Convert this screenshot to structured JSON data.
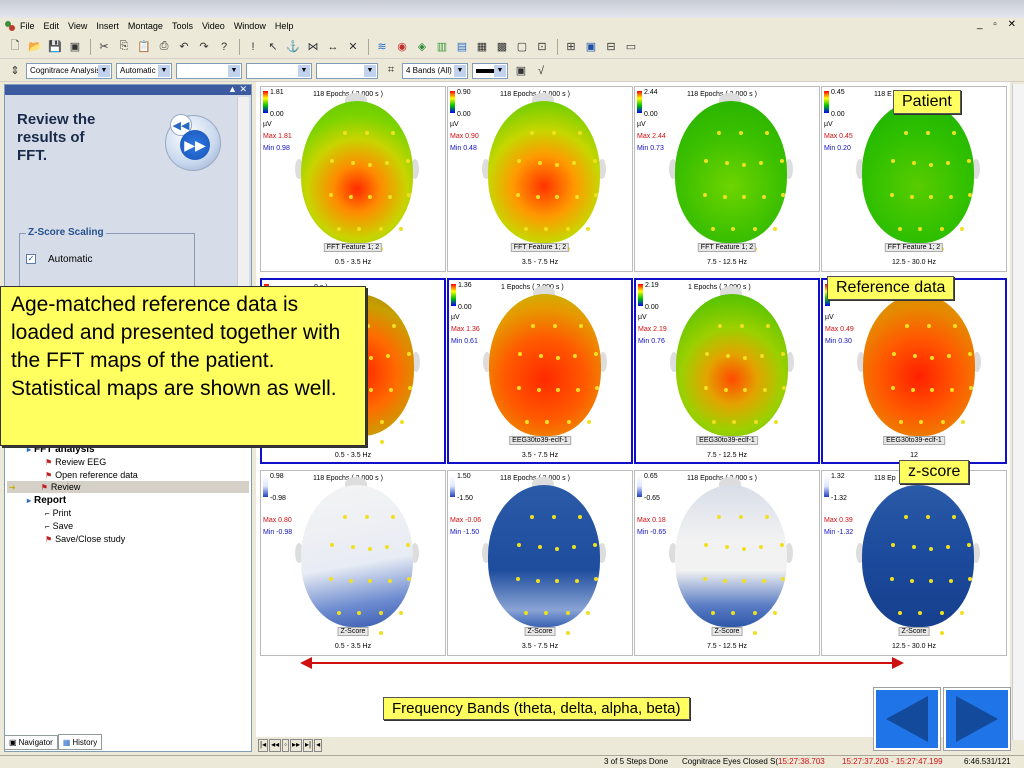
{
  "menu": [
    "File",
    "Edit",
    "View",
    "Insert",
    "Montage",
    "Tools",
    "Video",
    "Window",
    "Help"
  ],
  "window_controls": "_ ▫ ✕",
  "toolbar2": {
    "analysis_combo": "Cognitrace Analysis",
    "scaling_combo": "Automatic",
    "bands_combo": "4 Bands (All) (c"
  },
  "left_panel": {
    "heading": "Review the\nresults of\nFFT.",
    "zscore_title": "Z-Score Scaling",
    "automatic_label": "Automatic",
    "tree": {
      "fft_analysis": "FFT analysis",
      "review_eeg": "Review EEG",
      "open_reference": "Open reference data",
      "review": "Review",
      "report": "Report",
      "print": "Print",
      "save": "Save",
      "save_close": "Save/Close study"
    },
    "tabs": {
      "navigator": "Navigator",
      "history": "History"
    }
  },
  "grid": {
    "row1": [
      {
        "max": "1.81",
        "min": "0.00",
        "unit": "µV",
        "maxline": "Max  1.81",
        "minline": "Min  0.98",
        "epochs": "118 Epochs ( 2.000 s )",
        "feature": "FFT Feature 1; 2",
        "band": "0.5 - 3.5 Hz"
      },
      {
        "max": "0.90",
        "min": "0.00",
        "unit": "µV",
        "maxline": "Max  0.90",
        "minline": "Min  0.48",
        "epochs": "118 Epochs ( 2.000 s )",
        "feature": "FFT Feature 1; 2",
        "band": "3.5 - 7.5 Hz"
      },
      {
        "max": "2.44",
        "min": "0.00",
        "unit": "µV",
        "maxline": "Max  2.44",
        "minline": "Min  0.73",
        "epochs": "118 Epochs ( 2.000 s )",
        "feature": "FFT Feature 1; 2",
        "band": "7.5 - 12.5 Hz"
      },
      {
        "max": "0.45",
        "min": "0.00",
        "unit": "µV",
        "maxline": "Max  0.45",
        "minline": "Min  0.20",
        "epochs": "118 E",
        "feature": "FFT Feature 1; 2",
        "band": "12.5 - 30.0 Hz"
      }
    ],
    "row2": [
      {
        "max": "",
        "min": "",
        "unit": "",
        "maxline": "",
        "minline": "",
        "epochs": "0 s )",
        "feature": "eclf-1",
        "band": "0.5 - 3.5 Hz"
      },
      {
        "max": "1.36",
        "min": "0.00",
        "unit": "µV",
        "maxline": "Max  1.36",
        "minline": "Min  0.61",
        "epochs": "1 Epochs ( 2.000 s )",
        "feature": "EEG30to39-eclf-1",
        "band": "3.5 - 7.5 Hz"
      },
      {
        "max": "2.19",
        "min": "0.00",
        "unit": "µV",
        "maxline": "Max  2.19",
        "minline": "Min  0.76",
        "epochs": "1 Epochs ( 2.000 s )",
        "feature": "EEG30to39-eclf-1",
        "band": "7.5 - 12.5 Hz"
      },
      {
        "max": "",
        "min": "",
        "unit": "µV",
        "maxline": "Max  0.49",
        "minline": "Min  0.30",
        "epochs": "",
        "feature": "EEG30to39-eclf-1",
        "band": "12"
      }
    ],
    "row3": [
      {
        "max": "0.98",
        "min": "-0.98",
        "unit": "",
        "maxline": "Max  0.80",
        "minline": "Min  -0.98",
        "epochs": "118 Epochs ( 2.000 s )",
        "feature": "Z-Score",
        "band": "0.5 - 3.5 Hz"
      },
      {
        "max": "1.50",
        "min": "-1.50",
        "unit": "",
        "maxline": "Max  -0.06",
        "minline": "Min  -1.50",
        "epochs": "118 Epochs ( 2.000 s )",
        "feature": "Z-Score",
        "band": "3.5 - 7.5 Hz"
      },
      {
        "max": "0.65",
        "min": "-0.65",
        "unit": "",
        "maxline": "Max  0.18",
        "minline": "Min  -0.65",
        "epochs": "118 Epochs ( 2.000 s )",
        "feature": "Z-Score",
        "band": "7.5 - 12.5 Hz"
      },
      {
        "max": "1.32",
        "min": "-1.32",
        "unit": "",
        "maxline": "Max  0.39",
        "minline": "Min  -1.32",
        "epochs": "118 Ep",
        "feature": "Z-Score",
        "band": "12.5 - 30.0 Hz"
      }
    ]
  },
  "callouts": {
    "patient": "Patient",
    "reference": "Reference data",
    "zscore": "z-score",
    "big": "Age-matched reference data is loaded and presented together with the FFT maps of the patient. Statistical maps are shown as well.",
    "bands": "Frequency Bands (theta, delta, alpha, beta)"
  },
  "status": {
    "steps": "3 of 5 Steps Done",
    "recording": "Cognitrace Eyes Closed S(",
    "time1": "15:27:38.703",
    "time_range": "15:27:37.203 - 15:27:47.199",
    "position": "6:46.531/121"
  },
  "colors": {
    "accent_blue": "#1f74e8",
    "callout_yellow": "#ffff60",
    "arrow_red": "#d01010"
  }
}
